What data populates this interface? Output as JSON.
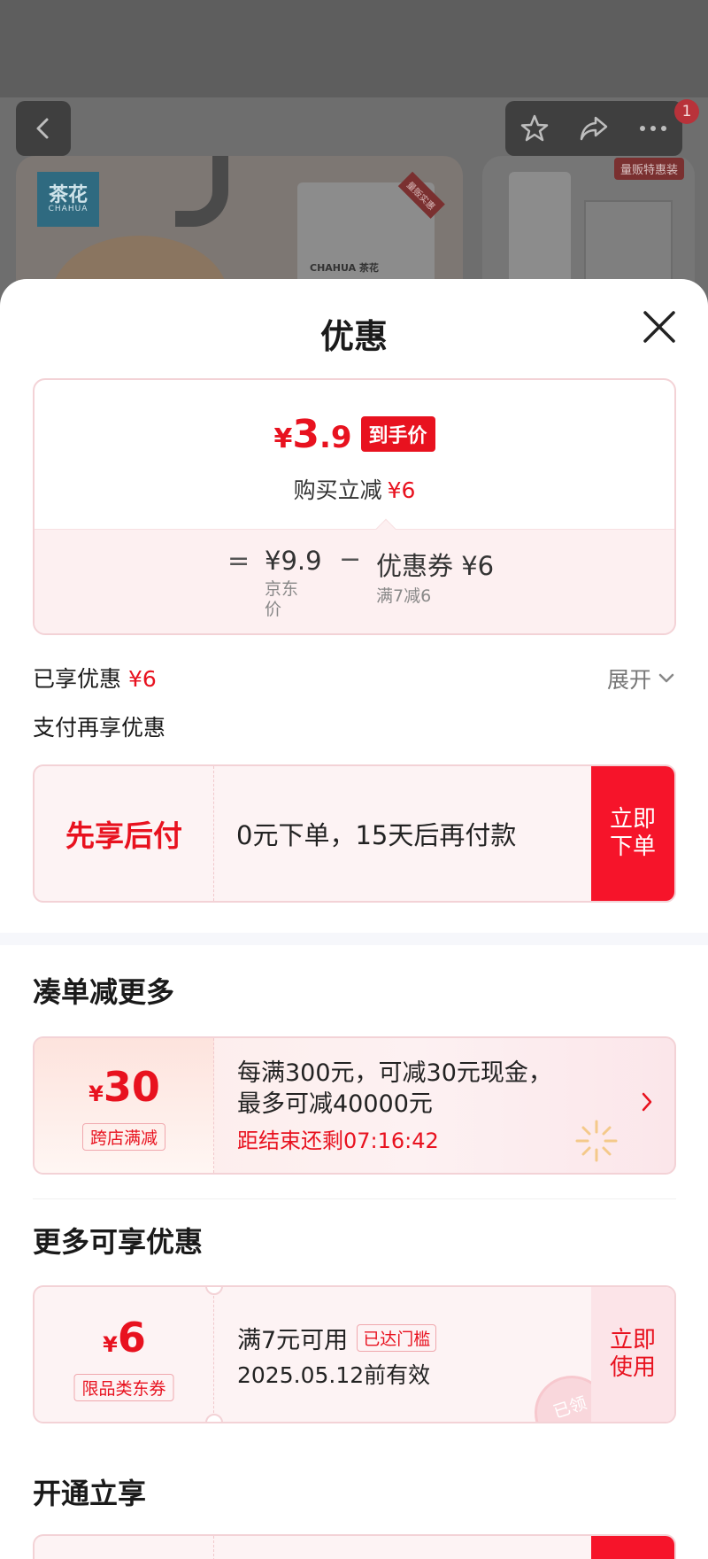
{
  "product_page": {
    "notification_count": "1",
    "brand_logo": "茶花",
    "brand_logo_sub": "CHAHUA",
    "pack_label": "CHAHUA 茶花",
    "pack_tag": "量贩实惠",
    "card2_tag": "量贩特惠装"
  },
  "sheet": {
    "title": "优惠",
    "price": {
      "currency": "¥",
      "integer": "3",
      "decimal": ".9",
      "tag": "到手价",
      "sub_label": "购买立减",
      "sub_value": "¥6"
    },
    "breakdown": {
      "equals": "=",
      "minus": "−",
      "jd_price_value": "¥9.9",
      "jd_price_label": "京东价",
      "coupon_value": "优惠券 ¥6",
      "coupon_label": "满7减6"
    },
    "enjoyed_label": "已享优惠",
    "enjoyed_value": "¥6",
    "expand_label": "展开",
    "pay_more_label": "支付再享优惠",
    "paylater": {
      "title": "先享后付",
      "desc": "0元下单，15天后再付款",
      "button": "立即下单"
    },
    "section_bundle": "凑单减更多",
    "promo": {
      "currency": "¥",
      "amount": "30",
      "label": "跨店满减",
      "desc_line1": "每满300元，可减30元现金，",
      "desc_line2": "最多可减40000元",
      "countdown": "距结束还剩07:16:42"
    },
    "section_more": "更多可享优惠",
    "coupon": {
      "currency": "¥",
      "amount": "6",
      "label": "限品类东券",
      "condition": "满7元可用",
      "threshold_badge": "已达门槛",
      "valid": "2025.05.12前有效",
      "button": "立即使用",
      "stamp": "已领"
    },
    "section_open": "开通立享"
  },
  "colors": {
    "accent_red": "#e8121f",
    "button_red": "#f6142a",
    "card_border": "#f3d2d6",
    "card_bg": "#fdf3f4"
  },
  "icons": [
    "back-arrow-icon",
    "star-icon",
    "share-icon",
    "more-icon",
    "close-icon",
    "chevron-down-icon",
    "chevron-right-icon",
    "sparkle-icon"
  ]
}
